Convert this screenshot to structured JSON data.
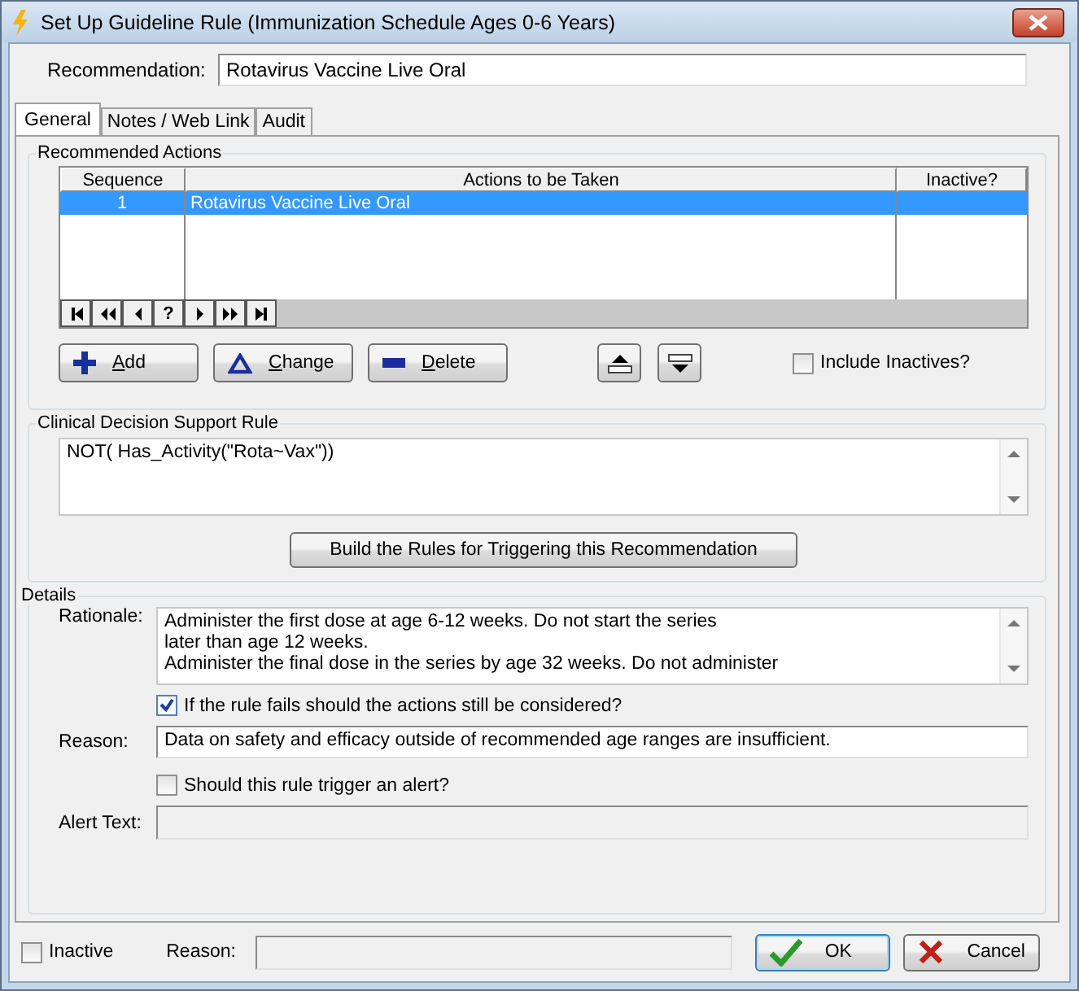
{
  "window": {
    "title": "Set Up Guideline Rule (Immunization Schedule Ages 0-6 Years)"
  },
  "recommendation": {
    "label": "Recommendation:",
    "value": "Rotavirus Vaccine Live Oral"
  },
  "tabs": [
    {
      "label": "General",
      "selected": true
    },
    {
      "label": "Notes / Web Link",
      "selected": false
    },
    {
      "label": "Audit",
      "selected": false
    }
  ],
  "recommended_actions": {
    "title": "Recommended Actions",
    "table": {
      "columns": [
        "Sequence",
        "Actions to be Taken",
        "Inactive?"
      ],
      "rows": [
        {
          "sequence": "1",
          "action": "Rotavirus Vaccine Live Oral",
          "selected": true
        }
      ]
    },
    "navigator": [
      {
        "kind": "first"
      },
      {
        "kind": "prev-page"
      },
      {
        "kind": "prev"
      },
      {
        "kind": "text",
        "label": "?"
      },
      {
        "kind": "next"
      },
      {
        "kind": "next-page"
      },
      {
        "kind": "last"
      }
    ],
    "buttons": [
      {
        "kind": "add",
        "label": "Add"
      },
      {
        "kind": "change",
        "label": "Change"
      },
      {
        "kind": "delete",
        "label": "Delete"
      }
    ],
    "move_buttons": [
      {
        "kind": "up"
      },
      {
        "kind": "down"
      }
    ],
    "include_inactives": {
      "label": "Include Inactives?",
      "checked": false
    }
  },
  "cds_rule": {
    "title": "Clinical Decision Support Rule",
    "value": "NOT( Has_Activity(\"Rota~Vax\"))",
    "build_button": "Build the Rules for Triggering this Recommendation"
  },
  "details": {
    "title": "Details",
    "rationale_label": "Rationale:",
    "rationale": "Administer the first dose at age 6-12 weeks. Do not start the series\nlater than age 12 weeks.\nAdminister the final dose in the series by age 32 weeks. Do not administer",
    "consider": {
      "label": "If the rule fails should the actions still be considered?",
      "checked": true
    },
    "reason_label": "Reason:",
    "reason": "Data on safety and efficacy outside of recommended age ranges are insufficient.",
    "alert": {
      "label": "Should this rule trigger an alert?",
      "checked": false
    },
    "alert_text_label": "Alert Text:"
  },
  "footer": {
    "inactive": {
      "label": "Inactive",
      "checked": false
    },
    "reason_label": "Reason:",
    "ok": "OK",
    "cancel": "Cancel"
  }
}
